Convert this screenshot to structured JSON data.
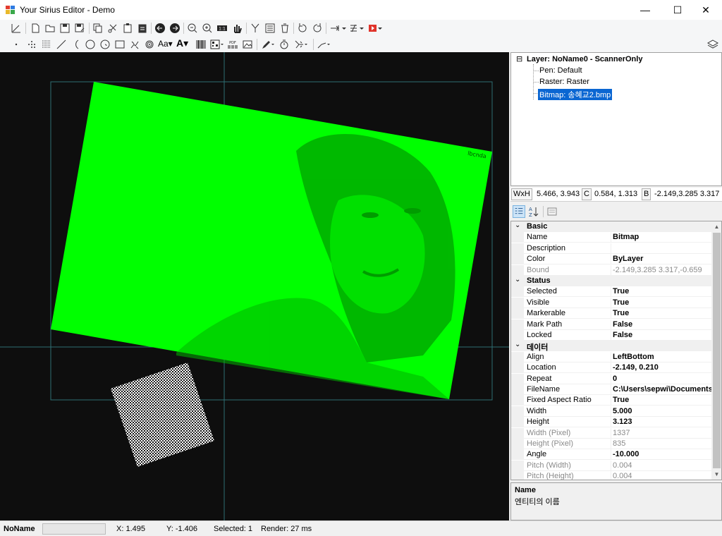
{
  "window": {
    "title": "Your Sirius Editor - Demo",
    "minimize": "—",
    "maximize": "☐",
    "close": "✕"
  },
  "toolbar1": {
    "icons": [
      "axis-icon",
      "new-file-icon",
      "open-folder-icon",
      "save-icon",
      "save-as-icon",
      "copy-icon",
      "cut-icon",
      "paste-icon",
      "paste-array-icon",
      "arrow-left-icon",
      "arrow-right-icon",
      "zoom-out-icon",
      "zoom-in-icon",
      "zoom-fit-icon",
      "pan-hand-icon",
      "merge-icon",
      "list-icon",
      "delete-icon",
      "rotate-ccw-icon",
      "rotate-cw-icon",
      "align-dropdown-icon",
      "split-dropdown-icon",
      "run-dropdown-icon"
    ]
  },
  "toolbar2": {
    "icons": [
      "point-icon",
      "points-icon",
      "raster-icon",
      "line-icon",
      "arc-icon",
      "circle-icon",
      "spiral-icon",
      "rectangle-icon",
      "stitch-icon",
      "trepan-icon",
      "text-dropdown-icon",
      "font-text-dropdown-icon",
      "barcode-icon",
      "matrix-dropdown-icon",
      "pdf417-icon",
      "image-icon",
      "pen-dropdown-icon",
      "timer-icon",
      "laser-dropdown-icon",
      "curve-dropdown-icon",
      "layers-icon"
    ],
    "text_label": "Aa▾",
    "font_label": "A▾"
  },
  "tree": {
    "layer": "Layer: NoName0 - ScannerOnly",
    "pen": "Pen: Default",
    "raster": "Raster: Raster",
    "bitmap": "Bitmap: 송혜교2.bmp",
    "expander": "⊟"
  },
  "dimensions": {
    "wh_key": "WxH",
    "wh_val": "5.466, 3.943",
    "c_key": "C",
    "c_val": "0.584, 1.313",
    "b_key": "B",
    "b_val": "-2.149,3.285 3.317"
  },
  "properties": {
    "rows": [
      {
        "type": "cat",
        "name": "Basic"
      },
      {
        "type": "prop",
        "name": "Name",
        "value": "Bitmap"
      },
      {
        "type": "prop",
        "name": "Description",
        "value": ""
      },
      {
        "type": "prop",
        "name": "Color",
        "value": "ByLayer"
      },
      {
        "type": "dim",
        "name": "Bound",
        "value": "-2.149,3.285 3.317,-0.659"
      },
      {
        "type": "cat",
        "name": "Status"
      },
      {
        "type": "prop",
        "name": "Selected",
        "value": "True"
      },
      {
        "type": "prop",
        "name": "Visible",
        "value": "True"
      },
      {
        "type": "prop",
        "name": "Markerable",
        "value": "True"
      },
      {
        "type": "prop",
        "name": "Mark Path",
        "value": "False"
      },
      {
        "type": "prop",
        "name": "Locked",
        "value": "False"
      },
      {
        "type": "cat",
        "name": "데이터"
      },
      {
        "type": "prop",
        "name": "Align",
        "value": "LeftBottom"
      },
      {
        "type": "prop",
        "name": "Location",
        "value": "-2.149, 0.210"
      },
      {
        "type": "prop",
        "name": "Repeat",
        "value": "0"
      },
      {
        "type": "prop",
        "name": "FileName",
        "value": "C:\\Users\\sepwi\\Documents"
      },
      {
        "type": "prop",
        "name": "Fixed Aspect Ratio",
        "value": "True"
      },
      {
        "type": "prop",
        "name": "Width",
        "value": "5.000"
      },
      {
        "type": "prop",
        "name": "Height",
        "value": "3.123"
      },
      {
        "type": "dim",
        "name": "Width (Pixel)",
        "value": "1337"
      },
      {
        "type": "dim",
        "name": "Height (Pixel)",
        "value": "835"
      },
      {
        "type": "prop",
        "name": "Angle",
        "value": "-10.000"
      },
      {
        "type": "dim",
        "name": "Pitch (Width)",
        "value": "0.004"
      },
      {
        "type": "dim",
        "name": "Pitch (Height)",
        "value": "0.004"
      }
    ]
  },
  "description": {
    "title": "Name",
    "text": "엔티티의 이름"
  },
  "status": {
    "name": "NoName",
    "x": "X: 1.495",
    "y": "Y: -1.406",
    "selected": "Selected: 1",
    "render": "Render: 27 ms"
  },
  "colors": {
    "canvas": "#0e0e0e",
    "bitmap": "#00ff00",
    "boundary": "#2e6f73",
    "selection": "#0a66d2"
  }
}
